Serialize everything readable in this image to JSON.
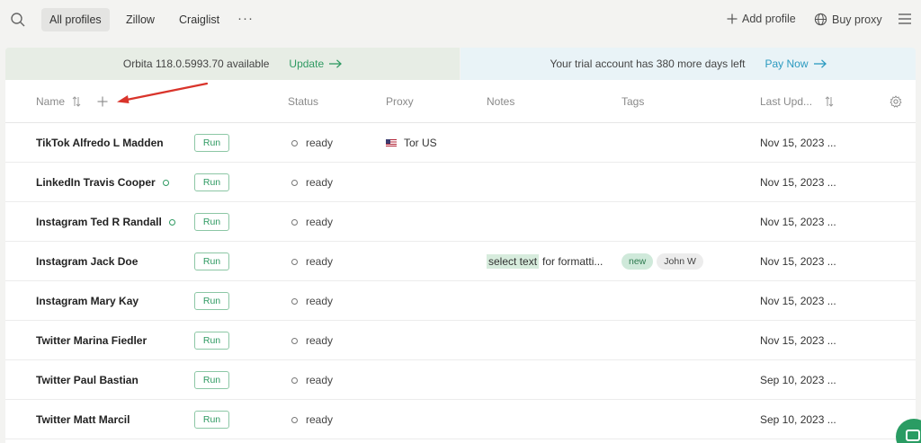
{
  "topbar": {
    "tabs": [
      {
        "label": "All profiles"
      },
      {
        "label": "Zillow"
      },
      {
        "label": "Craiglist"
      }
    ],
    "more": "···",
    "add_profile": "Add profile",
    "buy_proxy": "Buy proxy"
  },
  "banners": {
    "left_text": "Orbita 118.0.5993.70 available",
    "left_link": "Update",
    "right_text": "Your trial account has 380 more days left",
    "right_link": "Pay Now"
  },
  "table": {
    "columns": {
      "name": "Name",
      "status": "Status",
      "proxy": "Proxy",
      "notes": "Notes",
      "tags": "Tags",
      "updated": "Last Upd..."
    },
    "run_label": "Run",
    "rows": [
      {
        "name": "TikTok Alfredo L Madden",
        "status": "ready",
        "proxy": "Tor US",
        "notes_highlight": "",
        "notes_rest": "",
        "tags": [],
        "updated": "Nov 15, 2023 ...",
        "ring": false
      },
      {
        "name": "LinkedIn Travis Cooper",
        "status": "ready",
        "proxy": "",
        "notes_highlight": "",
        "notes_rest": "",
        "tags": [],
        "updated": "Nov 15, 2023 ...",
        "ring": true
      },
      {
        "name": "Instagram Ted R Randall",
        "status": "ready",
        "proxy": "",
        "notes_highlight": "",
        "notes_rest": "",
        "tags": [],
        "updated": "Nov 15, 2023 ...",
        "ring": true
      },
      {
        "name": "Instagram Jack Doe",
        "status": "ready",
        "proxy": "",
        "notes_highlight": "select text",
        "notes_rest": "for formatti...",
        "tags": [
          "new",
          "John W"
        ],
        "updated": "Nov 15, 2023 ...",
        "ring": false
      },
      {
        "name": "Instagram Mary Kay",
        "status": "ready",
        "proxy": "",
        "notes_highlight": "",
        "notes_rest": "",
        "tags": [],
        "updated": "Nov 15, 2023 ...",
        "ring": false
      },
      {
        "name": "Twitter Marina Fiedler",
        "status": "ready",
        "proxy": "",
        "notes_highlight": "",
        "notes_rest": "",
        "tags": [],
        "updated": "Nov 15, 2023 ...",
        "ring": false
      },
      {
        "name": "Twitter Paul Bastian",
        "status": "ready",
        "proxy": "",
        "notes_highlight": "",
        "notes_rest": "",
        "tags": [],
        "updated": "Sep 10, 2023 ...",
        "ring": false
      },
      {
        "name": "Twitter Matt Marcil",
        "status": "ready",
        "proxy": "",
        "notes_highlight": "",
        "notes_rest": "",
        "tags": [],
        "updated": "Sep 10, 2023 ...",
        "ring": false
      }
    ]
  },
  "colors": {
    "accent_green": "#2f9a62",
    "accent_blue": "#2b9ac0",
    "annotation_red": "#d9342b"
  }
}
